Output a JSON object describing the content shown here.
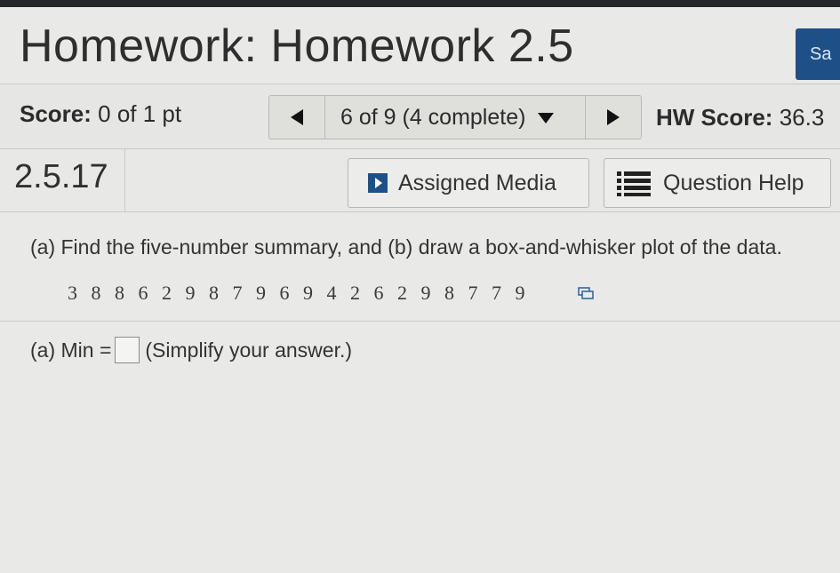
{
  "header": {
    "title": "Homework: Homework 2.5",
    "save_label": "Sa"
  },
  "score_bar": {
    "score_label": "Score:",
    "score_value": "0 of 1 pt",
    "nav_label": "6 of 9 (4 complete)",
    "hw_score_label": "HW Score:",
    "hw_score_value": "36.3"
  },
  "question": {
    "number": "2.5.17",
    "assigned_media_label": "Assigned Media",
    "question_help_label": "Question Help",
    "prompt": "(a) Find the five-number summary, and (b) draw a box-and-whisker plot of the data.",
    "data_values": "3 8 8 6 2 9 8 7 9 6 9 4 2 6 2 9 8 7 7 9",
    "answer_prefix": "(a) Min =",
    "answer_suffix": "(Simplify your answer.)",
    "answer_value": ""
  },
  "colors": {
    "save_button": "#1f4f87",
    "media_icon": "#1f4f87"
  },
  "icons": [
    "triangle-left-icon",
    "caret-down-icon",
    "triangle-right-icon",
    "media-play-icon",
    "list-icon",
    "copy-icon"
  ]
}
